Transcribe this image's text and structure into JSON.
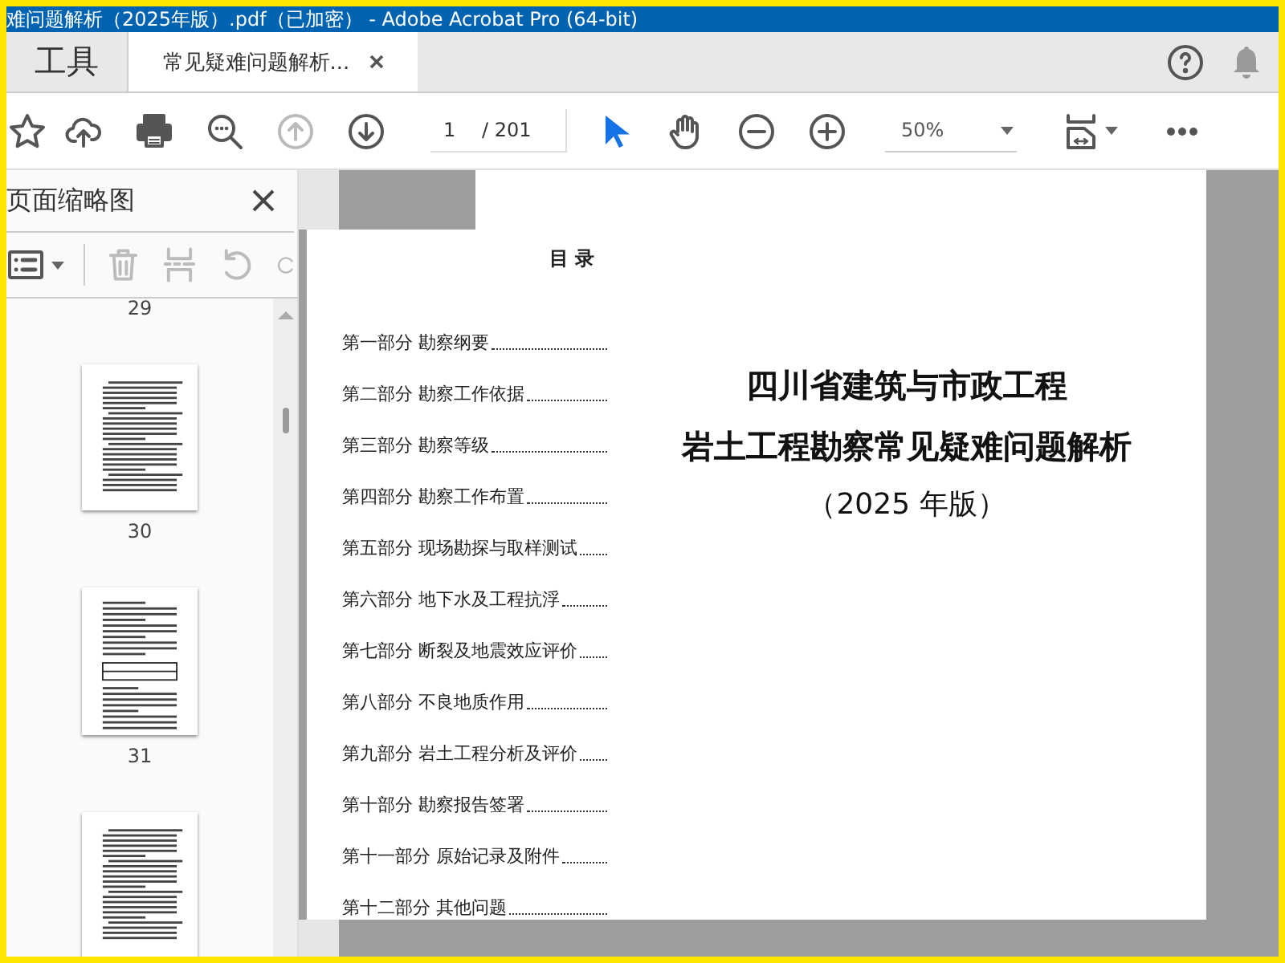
{
  "window": {
    "title": "难问题解析（2025年版）.pdf（已加密） - Adobe Acrobat Pro (64-bit)"
  },
  "tabs": [
    {
      "label": "工具",
      "kind": "home",
      "selected": false
    },
    {
      "label": "常见疑难问题解析...",
      "kind": "document",
      "selected": true
    }
  ],
  "toolbar": {
    "page_number": "1",
    "page_total": "/ 201",
    "zoom": "50%",
    "select_tool_selected": true,
    "previous_page_disabled": true
  },
  "sidebar": {
    "title": "页面缩略图",
    "thumbnails": [
      {
        "label": "29",
        "kind": "partial"
      },
      {
        "label": "30",
        "kind": "text"
      },
      {
        "label": "31",
        "kind": "table"
      },
      {
        "kind": "text"
      }
    ]
  },
  "document": {
    "toc_title": "目 录",
    "toc": [
      {
        "part": "第一部分",
        "title": "勘察纲要"
      },
      {
        "part": "第二部分",
        "title": "勘察工作依据"
      },
      {
        "part": "第三部分",
        "title": "勘察等级"
      },
      {
        "part": "第四部分",
        "title": "勘察工作布置"
      },
      {
        "part": "第五部分",
        "title": "现场勘探与取样测试"
      },
      {
        "part": "第六部分",
        "title": "地下水及工程抗浮"
      },
      {
        "part": "第七部分",
        "title": "断裂及地震效应评价"
      },
      {
        "part": "第八部分",
        "title": "不良地质作用"
      },
      {
        "part": "第九部分",
        "title": "岩土工程分析及评价"
      },
      {
        "part": "第十部分",
        "title": "勘察报告签署"
      },
      {
        "part": "第十一部分",
        "title": "原始记录及附件"
      },
      {
        "part": "第十二部分",
        "title": "其他问题"
      }
    ],
    "title_lines": [
      "四川省建筑与市政工程",
      "岩土工程勘察常见疑难问题解析"
    ],
    "edition": "（2025 年版）"
  }
}
